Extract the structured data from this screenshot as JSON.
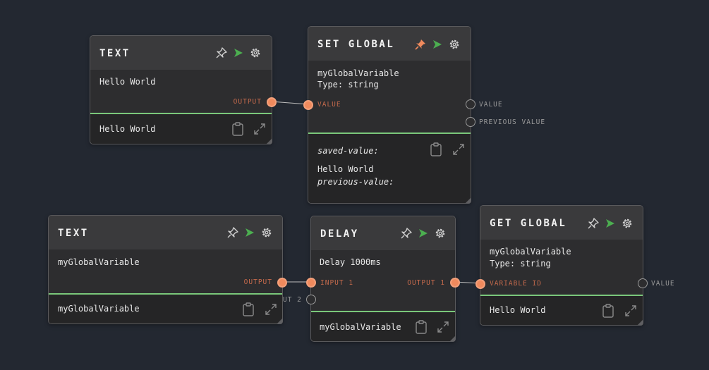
{
  "nodes": {
    "text1": {
      "title": "TEXT",
      "content": "Hello World",
      "output_label": "OUTPUT",
      "footer_value": "Hello World"
    },
    "set_global": {
      "title": "SET GLOBAL",
      "variable": "myGlobalVariable",
      "type": "Type: string",
      "input_label": "VALUE",
      "output_value_label": "VALUE",
      "output_previous_label": "PREVIOUS VALUE",
      "saved_value_label": "saved-value:",
      "saved_value": "Hello World",
      "previous_value_label": "previous-value:"
    },
    "text2": {
      "title": "TEXT",
      "content": "myGlobalVariable",
      "output_label": "OUTPUT",
      "footer_value": "myGlobalVariable"
    },
    "delay": {
      "title": "DELAY",
      "content": "Delay 1000ms",
      "input1_label": "INPUT 1",
      "input2_label": "UT 2",
      "output1_label": "OUTPUT 1",
      "footer_value": "myGlobalVariable"
    },
    "get_global": {
      "title": "GET GLOBAL",
      "variable": "myGlobalVariable",
      "type": "Type: string",
      "input_label": "VARIABLE ID",
      "output_label": "VALUE",
      "footer_value": "Hello World"
    }
  },
  "colors": {
    "background": "#232831",
    "node_bg": "#2d2d2f",
    "accent_orange": "#f08a5d",
    "accent_green": "#4caf50",
    "separator_green": "#7ac77a"
  },
  "icons": [
    "pin-icon",
    "run-icon",
    "gear-icon",
    "clipboard-icon",
    "expand-icon"
  ]
}
